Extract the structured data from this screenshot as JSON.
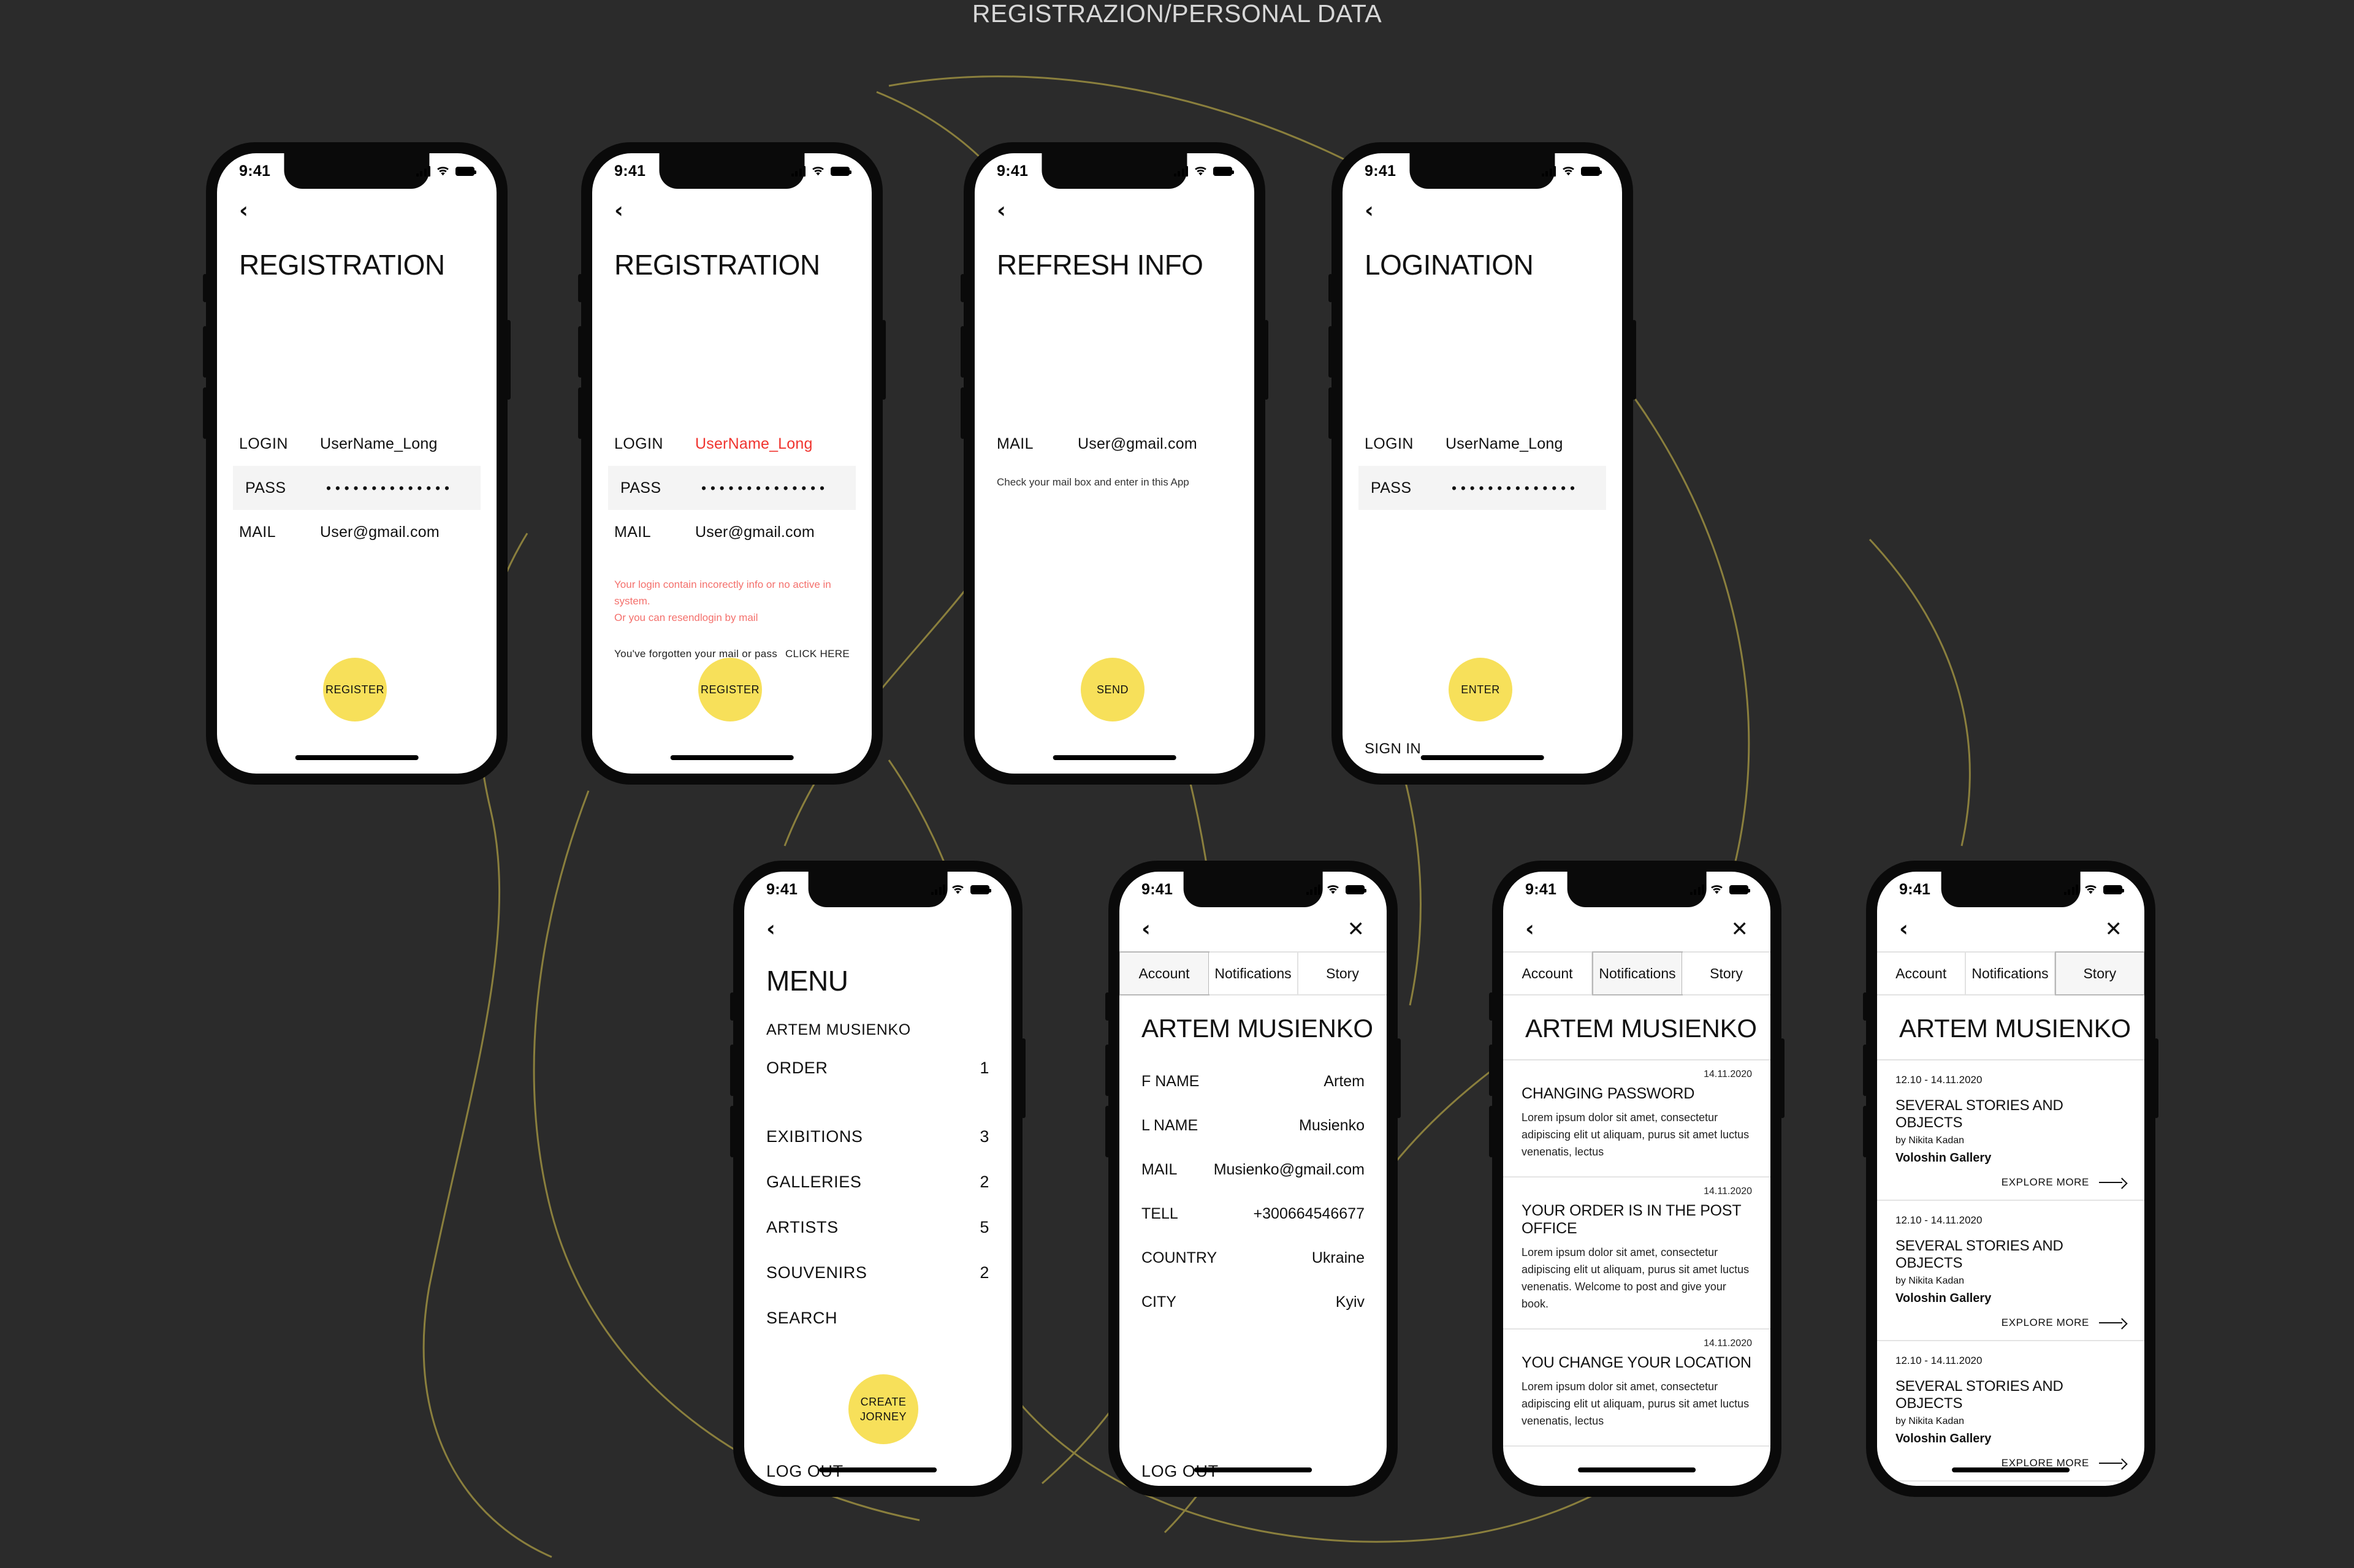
{
  "board": {
    "title": "REGISTRAZION/PERSONAL DATA",
    "background_color": "#2b2b2b",
    "curve_color": "#8a7f3d",
    "accent_color": "#f7e05a",
    "error_color": "#f0342f"
  },
  "status_bar": {
    "time": "9:41"
  },
  "icons": {
    "back": "‹",
    "close": "✕"
  },
  "screens": {
    "registration": {
      "title": "REGISTRATION",
      "fields": [
        {
          "label": "LOGIN",
          "value": "UserName_Long"
        },
        {
          "label": "PASS",
          "value": "• • • • • • • • • • • • • •"
        },
        {
          "label": "MAIL",
          "value": "User@gmail.com"
        }
      ],
      "submit": "REGISTER"
    },
    "registration_error": {
      "title": "REGISTRATION",
      "fields": [
        {
          "label": "LOGIN",
          "value": "UserName_Long"
        },
        {
          "label": "PASS",
          "value": "• • • • • • • • • • • • • •"
        },
        {
          "label": "MAIL",
          "value": "User@gmail.com"
        }
      ],
      "error_line1": "Your login contain incorectly info or no active in system.",
      "error_line2": "Or you can resendlogin by mail",
      "forgot_text": "You've forgotten your mail or pass",
      "forgot_link": "CLICK HERE",
      "submit": "REGISTER"
    },
    "refresh_info": {
      "title": "REFRESH INFO",
      "fields": [
        {
          "label": "MAIL",
          "value": "User@gmail.com"
        }
      ],
      "hint": "Check your mail box and enter in this App",
      "submit": "SEND"
    },
    "logination": {
      "title": "LOGINATION",
      "fields": [
        {
          "label": "LOGIN",
          "value": "UserName_Long"
        },
        {
          "label": "PASS",
          "value": "• • • • • • • • • • • • • •"
        }
      ],
      "submit": "ENTER",
      "sign_in": "SIGN IN"
    },
    "menu": {
      "title": "MENU",
      "user_name": "ARTEM MUSIENKO",
      "items": [
        {
          "label": "ORDER",
          "count": "1"
        },
        {
          "label": "EXIBITIONS",
          "count": "3"
        },
        {
          "label": "GALLERIES",
          "count": "2"
        },
        {
          "label": "ARTISTS",
          "count": "5"
        },
        {
          "label": "SOUVENIRS",
          "count": "2"
        },
        {
          "label": "SEARCH",
          "count": ""
        }
      ],
      "create_journey_line1": "CREATE",
      "create_journey_line2": "JORNEY",
      "log_out": "LOG OUT"
    },
    "account": {
      "tabs": [
        {
          "label": "Account",
          "active": true
        },
        {
          "label": "Notifications",
          "active": false
        },
        {
          "label": "Story",
          "active": false
        }
      ],
      "title": "ARTEM MUSIENKO",
      "rows": [
        {
          "label": "F NAME",
          "value": "Artem"
        },
        {
          "label": "L NAME",
          "value": "Musienko"
        },
        {
          "label": "MAIL",
          "value": "Musienko@gmail.com"
        },
        {
          "label": "TELL",
          "value": "+300664546677"
        },
        {
          "label": "COUNTRY",
          "value": "Ukraine"
        },
        {
          "label": "CITY",
          "value": "Kyiv"
        }
      ],
      "log_out": "LOG OUT"
    },
    "notifications": {
      "tabs": [
        {
          "label": "Account",
          "active": false
        },
        {
          "label": "Notifications",
          "active": true
        },
        {
          "label": "Story",
          "active": false
        }
      ],
      "title": "ARTEM MUSIENKO",
      "items": [
        {
          "date": "14.11.2020",
          "title": "CHANGING PASSWORD",
          "body": "Lorem ipsum dolor sit amet, consectetur adipiscing elit ut aliquam, purus sit amet luctus venenatis, lectus"
        },
        {
          "date": "14.11.2020",
          "title": "YOUR ORDER IS IN THE POST OFFICE",
          "body": "Lorem ipsum dolor sit amet, consectetur adipiscing elit ut aliquam, purus sit amet luctus venenatis. Welcome to post and give your book."
        },
        {
          "date": "14.11.2020",
          "title": "YOU CHANGE YOUR LOCATION",
          "body": "Lorem ipsum dolor sit amet, consectetur adipiscing elit ut aliquam, purus sit amet luctus venenatis, lectus"
        }
      ]
    },
    "story": {
      "tabs": [
        {
          "label": "Account",
          "active": false
        },
        {
          "label": "Notifications",
          "active": false
        },
        {
          "label": "Story",
          "active": true
        }
      ],
      "title": "ARTEM MUSIENKO",
      "items": [
        {
          "date": "12.10 - 14.11.2020",
          "title": "SEVERAL STORIES AND OBJECTS",
          "author": "by Nikita Kadan",
          "gallery": "Voloshin Gallery",
          "more": "EXPLORE MORE"
        },
        {
          "date": "12.10 - 14.11.2020",
          "title": "SEVERAL STORIES AND OBJECTS",
          "author": "by Nikita Kadan",
          "gallery": "Voloshin Gallery",
          "more": "EXPLORE MORE"
        },
        {
          "date": "12.10 - 14.11.2020",
          "title": "SEVERAL STORIES AND OBJECTS",
          "author": "by Nikita Kadan",
          "gallery": "Voloshin Gallery",
          "more": "EXPLORE MORE"
        }
      ]
    }
  }
}
